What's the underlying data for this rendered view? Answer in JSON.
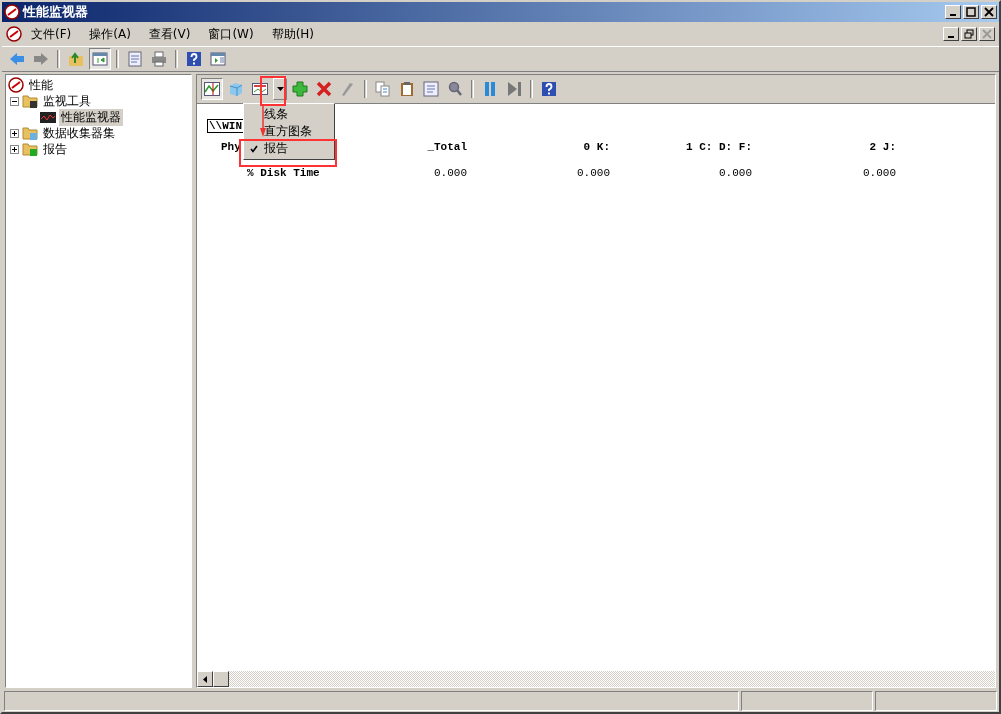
{
  "window": {
    "title": "性能监视器"
  },
  "menu_bar": [
    "文件(F)",
    "操作(A)",
    "查看(V)",
    "窗口(W)",
    "帮助(H)"
  ],
  "tree": [
    {
      "label": "性能",
      "kind": "root",
      "selected": false,
      "children": [
        {
          "label": "监视工具",
          "kind": "folder",
          "selected": false,
          "expanded": true,
          "children": [
            {
              "label": "性能监视器",
              "kind": "monitor",
              "selected": true
            }
          ]
        },
        {
          "label": "数据收集器集",
          "kind": "folder",
          "selected": false,
          "expanded": false
        },
        {
          "label": "报告",
          "kind": "folder",
          "selected": false,
          "expanded": false
        }
      ]
    }
  ],
  "graph_type_menu": [
    {
      "label": "线条",
      "checked": false
    },
    {
      "label": "直方图条",
      "checked": false
    },
    {
      "label": "报告",
      "checked": true
    }
  ],
  "report": {
    "computer": "\\\\WIN",
    "object": "Phy",
    "counter": "% Disk Time",
    "columns": [
      "_Total",
      "0 K:",
      "1 C: D: F:",
      "2 J:"
    ],
    "values": [
      "0.000",
      "0.000",
      "0.000",
      "0.000"
    ]
  }
}
